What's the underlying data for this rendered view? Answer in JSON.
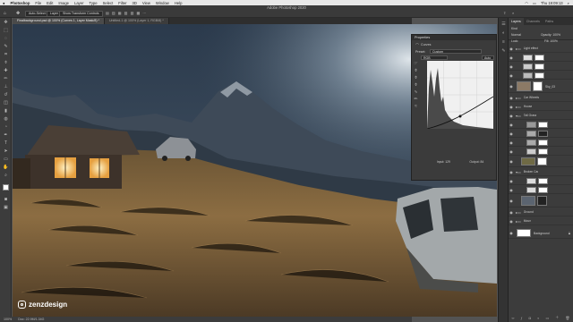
{
  "menubar": {
    "items": [
      "Photoshop",
      "File",
      "Edit",
      "Image",
      "Layer",
      "Type",
      "Select",
      "Filter",
      "3D",
      "View",
      "Window",
      "Help"
    ],
    "clock": "Thu 19:09:13"
  },
  "optionsbar": {
    "app_title": "Adobe Photoshop 2020",
    "auto_select": "Auto-Select:",
    "layer_select": "Layer",
    "show_transform": "Show Transform Controls"
  },
  "tabs": [
    {
      "label": "Finalbackground.psd @ 100% (Curves 1, Layer Mask/8) *"
    },
    {
      "label": "Untitled-1 @ 100% (Layer 1, RGB/8) *"
    }
  ],
  "status": {
    "zoom": "100%",
    "doc": "Doc: 22.9M/1.34G"
  },
  "properties": {
    "title": "Properties",
    "section": "Curves",
    "preset_label": "Preset:",
    "preset_value": "Custom",
    "channel_value": "RGB",
    "auto_label": "Auto",
    "input_label": "Input: 129",
    "output_label": "Output: 84"
  },
  "layers_panel": {
    "tabs": [
      "Layers",
      "Channels",
      "Paths"
    ],
    "kind": "Kind",
    "blend": "Normal",
    "opacity": "Opacity: 100%",
    "lock": "Lock:",
    "fill": "Fill: 100%",
    "layers": [
      {
        "name": "Light effect",
        "type": "folder"
      },
      {
        "name": "",
        "type": "layer"
      },
      {
        "name": "",
        "type": "layer"
      },
      {
        "name": "",
        "type": "layer"
      },
      {
        "name": "Sky_03",
        "type": "layer"
      },
      {
        "name": "Car Wheels",
        "type": "folder"
      },
      {
        "name": "House",
        "type": "folder"
      },
      {
        "name": "Tall Grass",
        "type": "folder"
      },
      {
        "name": "",
        "type": "layer"
      },
      {
        "name": "",
        "type": "layer"
      },
      {
        "name": "",
        "type": "layer"
      },
      {
        "name": "",
        "type": "layer"
      },
      {
        "name": "",
        "type": "layer"
      },
      {
        "name": "Broken Car",
        "type": "folder"
      },
      {
        "name": "",
        "type": "layer"
      },
      {
        "name": "",
        "type": "layer"
      },
      {
        "name": "",
        "type": "layer"
      },
      {
        "name": "Ground",
        "type": "folder"
      },
      {
        "name": "Moun",
        "type": "folder"
      },
      {
        "name": "Background",
        "type": "layer"
      }
    ]
  },
  "watermark": {
    "handle": "zenzdesign"
  },
  "colors": {
    "accent": "#4a90e2",
    "panel": "#3c3c3c",
    "window_glow": "#ffd98a"
  }
}
